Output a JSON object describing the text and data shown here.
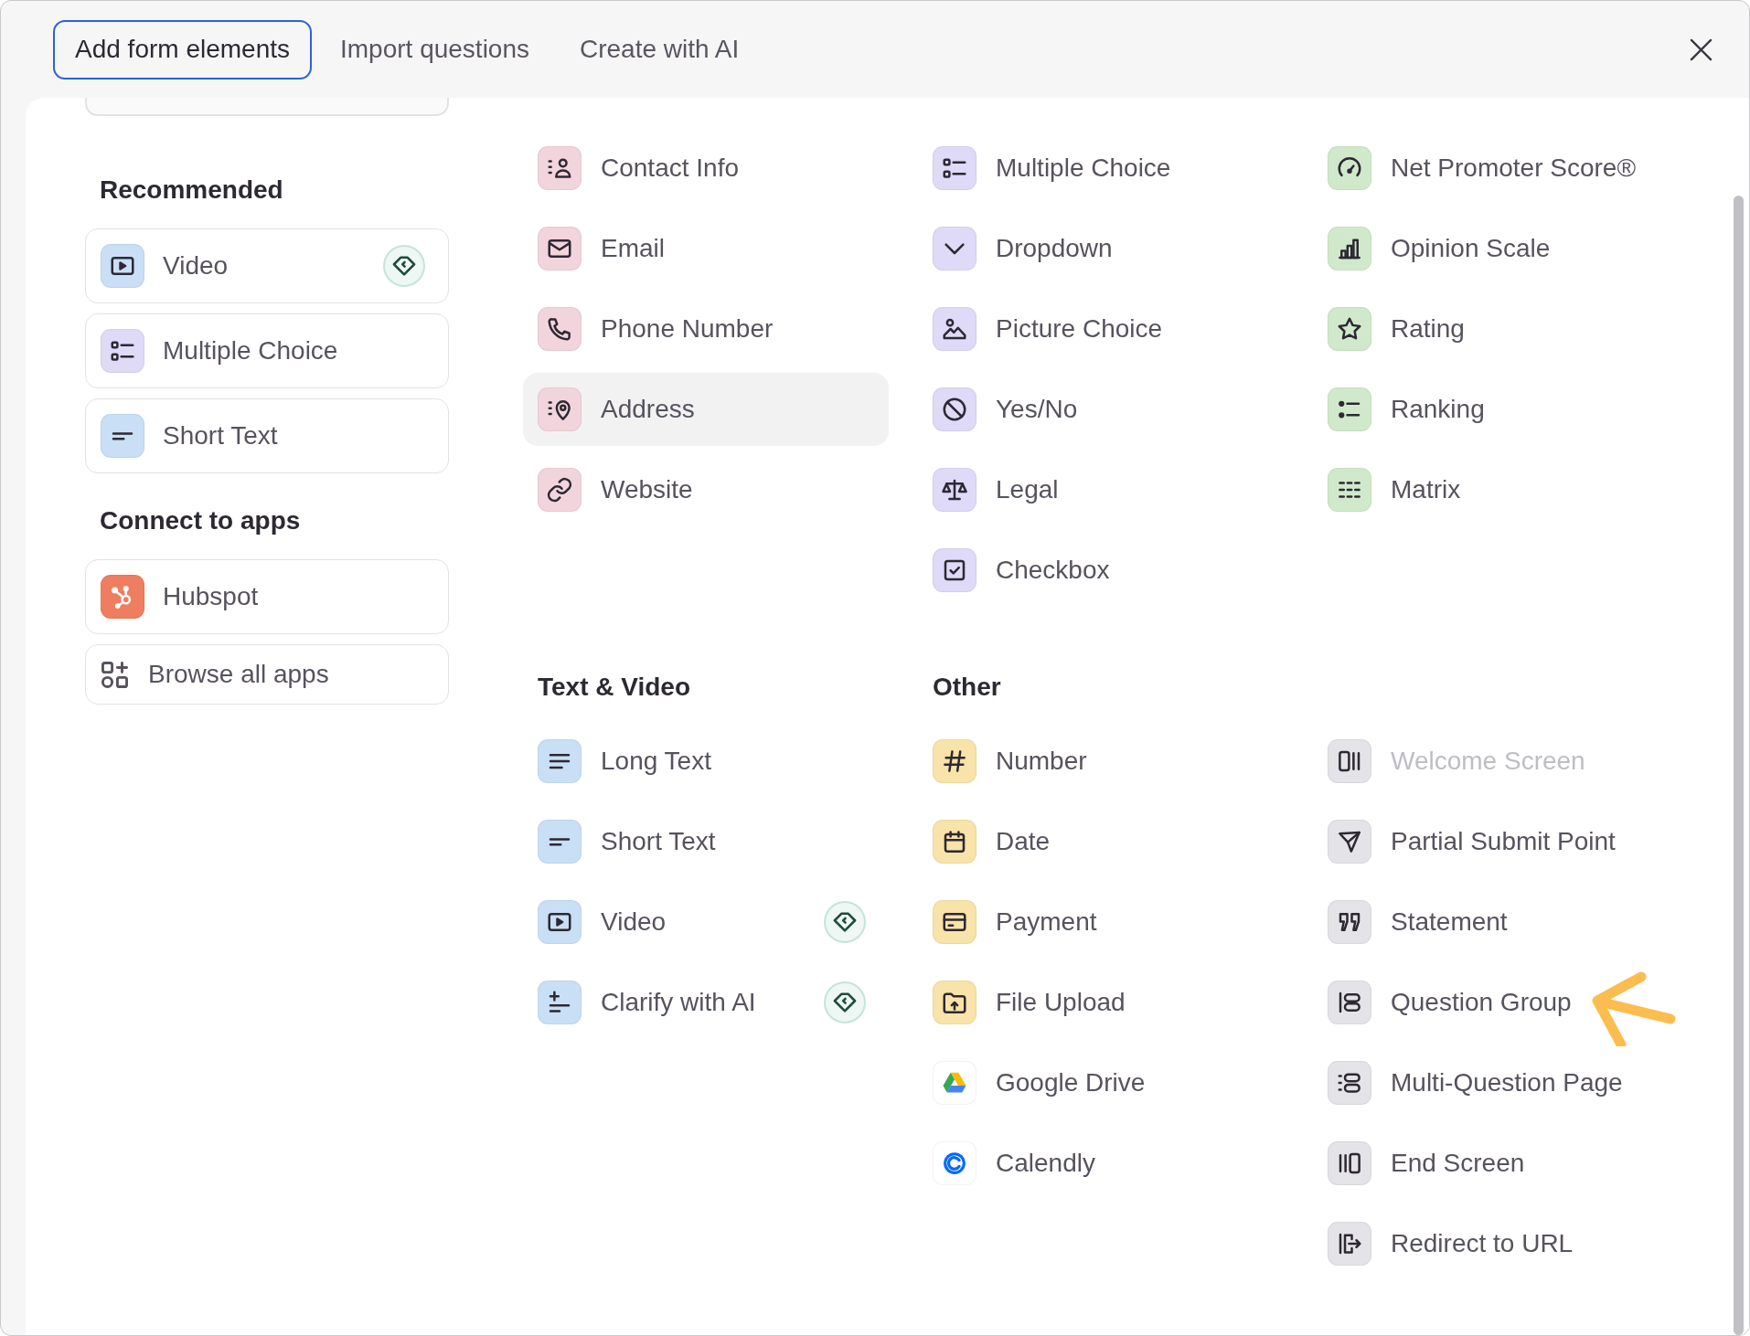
{
  "tabs": [
    {
      "label": "Add form elements",
      "selected": true
    },
    {
      "label": "Import questions",
      "selected": false
    },
    {
      "label": "Create with AI",
      "selected": false
    }
  ],
  "sidebar": {
    "sections": [
      {
        "title": "Recommended",
        "items": [
          {
            "kind": "video",
            "label": "Video",
            "color": "#c8dff6",
            "premium": true
          },
          {
            "kind": "multiple_choice",
            "label": "Multiple Choice",
            "color": "#dedaf7",
            "premium": false
          },
          {
            "kind": "short_text",
            "label": "Short Text",
            "color": "#c8dff6",
            "premium": false
          }
        ]
      },
      {
        "title": "Connect to apps",
        "items": [
          {
            "kind": "hubspot",
            "label": "Hubspot",
            "color": "#ee7e5f"
          },
          {
            "kind": "browse_apps",
            "label": "Browse all apps"
          }
        ]
      }
    ]
  },
  "groups": [
    {
      "columns": [
        [
          {
            "kind": "contact_info",
            "label": "Contact Info",
            "color": "#f2d4dd",
            "highlighted": false
          },
          {
            "kind": "email",
            "label": "Email",
            "color": "#f2d4dd",
            "highlighted": false
          },
          {
            "kind": "phone",
            "label": "Phone Number",
            "color": "#f2d4dd",
            "highlighted": false
          },
          {
            "kind": "address",
            "label": "Address",
            "color": "#f2d4dd",
            "highlighted": true
          },
          {
            "kind": "website",
            "label": "Website",
            "color": "#f2d4dd",
            "highlighted": false
          }
        ]
      ]
    },
    {
      "columns": [
        [
          {
            "kind": "multiple_choice",
            "label": "Multiple Choice",
            "color": "#dedaf7"
          },
          {
            "kind": "dropdown",
            "label": "Dropdown",
            "color": "#dedaf7"
          },
          {
            "kind": "picture_choice",
            "label": "Picture Choice",
            "color": "#dedaf7"
          },
          {
            "kind": "yes_no",
            "label": "Yes/No",
            "color": "#dedaf7"
          },
          {
            "kind": "legal",
            "label": "Legal",
            "color": "#dedaf7"
          },
          {
            "kind": "checkbox",
            "label": "Checkbox",
            "color": "#dedaf7"
          }
        ]
      ]
    },
    {
      "columns": [
        [
          {
            "kind": "nps",
            "label": "Net Promoter Score®",
            "color": "#d0e9cb"
          },
          {
            "kind": "opinion_scale",
            "label": "Opinion Scale",
            "color": "#d0e9cb"
          },
          {
            "kind": "rating",
            "label": "Rating",
            "color": "#d0e9cb"
          },
          {
            "kind": "ranking",
            "label": "Ranking",
            "color": "#d0e9cb"
          },
          {
            "kind": "matrix",
            "label": "Matrix",
            "color": "#d0e9cb"
          }
        ]
      ]
    },
    {
      "title": "Text & Video",
      "columns": [
        [
          {
            "kind": "long_text",
            "label": "Long Text",
            "color": "#c8dff6",
            "premium": false
          },
          {
            "kind": "short_text",
            "label": "Short Text",
            "color": "#c8dff6",
            "premium": false
          },
          {
            "kind": "video",
            "label": "Video",
            "color": "#c8dff6",
            "premium": true
          },
          {
            "kind": "clarify_ai",
            "label": "Clarify with AI",
            "color": "#c8dff6",
            "premium": true
          }
        ]
      ]
    },
    {
      "title": "Other",
      "columns": [
        [
          {
            "kind": "number",
            "label": "Number",
            "color": "#f8e3a8"
          },
          {
            "kind": "date",
            "label": "Date",
            "color": "#f8e3a8"
          },
          {
            "kind": "payment",
            "label": "Payment",
            "color": "#f8e3a8"
          },
          {
            "kind": "file_upload",
            "label": "File Upload",
            "color": "#f8e3a8"
          },
          {
            "kind": "google_drive",
            "label": "Google Drive",
            "color": "#ffffff"
          },
          {
            "kind": "calendly",
            "label": "Calendly",
            "color": "#ffffff"
          }
        ],
        [
          {
            "kind": "welcome_screen",
            "label": "Welcome Screen",
            "color": "#e4e3e7",
            "disabled": true,
            "pointed_at": false
          },
          {
            "kind": "partial_submit",
            "label": "Partial Submit Point",
            "color": "#e4e3e7",
            "disabled": false,
            "pointed_at": false
          },
          {
            "kind": "statement",
            "label": "Statement",
            "color": "#e4e3e7",
            "disabled": false,
            "pointed_at": false
          },
          {
            "kind": "question_group",
            "label": "Question Group",
            "color": "#e4e3e7",
            "disabled": false,
            "pointed_at": true
          },
          {
            "kind": "multi_question",
            "label": "Multi-Question Page",
            "color": "#e4e3e7",
            "disabled": false,
            "pointed_at": false
          },
          {
            "kind": "end_screen",
            "label": "End Screen",
            "color": "#e4e3e7",
            "disabled": false,
            "pointed_at": false
          },
          {
            "kind": "redirect",
            "label": "Redirect to URL",
            "color": "#e4e3e7",
            "disabled": false,
            "pointed_at": false
          }
        ]
      ]
    }
  ]
}
